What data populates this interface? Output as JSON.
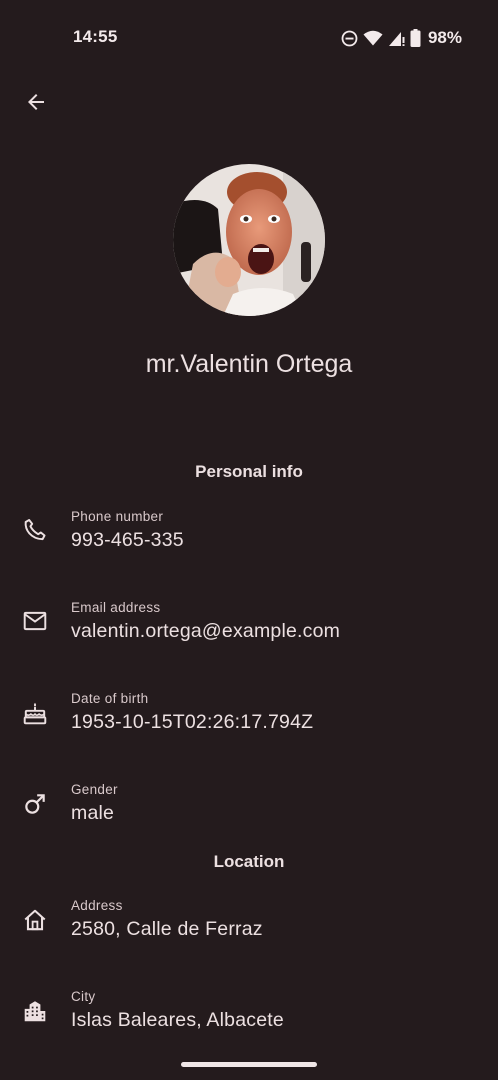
{
  "status_bar": {
    "time": "14:55",
    "battery_percent": "98%",
    "icons": [
      "do-not-disturb-icon",
      "wifi-icon",
      "signal-icon",
      "battery-icon"
    ]
  },
  "header": {
    "back_icon": "arrow-back-icon"
  },
  "profile": {
    "name": "mr.Valentin Ortega"
  },
  "sections": {
    "personal_title": "Personal info",
    "location_title": "Location"
  },
  "personal_info": {
    "phone": {
      "label": "Phone number",
      "value": "993-465-335",
      "icon": "phone-icon"
    },
    "email": {
      "label": "Email address",
      "value": "valentin.ortega@example.com",
      "icon": "mail-icon"
    },
    "dob": {
      "label": "Date of birth",
      "value": "1953-10-15T02:26:17.794Z",
      "icon": "cake-icon"
    },
    "gender": {
      "label": "Gender",
      "value": "male",
      "icon": "male-icon"
    }
  },
  "location": {
    "address": {
      "label": "Address",
      "value": "2580, Calle de Ferraz",
      "icon": "home-icon"
    },
    "city": {
      "label": "City",
      "value": "Islas Baleares, Albacete",
      "icon": "city-icon"
    }
  },
  "colors": {
    "background": "#241b1d",
    "text": "#ece0e1",
    "secondary_text": "#d9c9cb"
  }
}
